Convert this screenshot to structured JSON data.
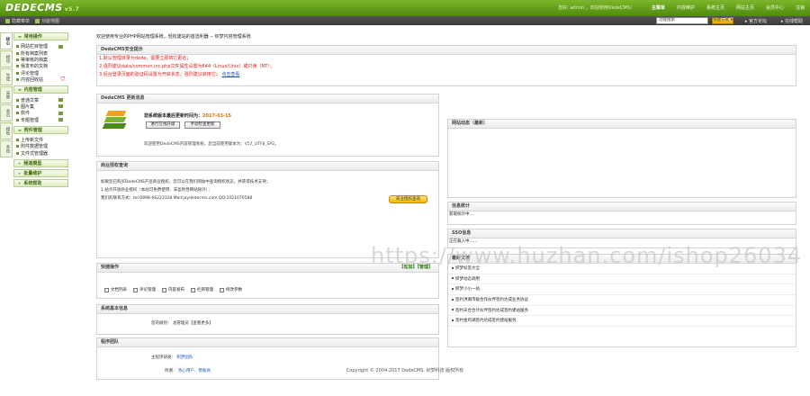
{
  "app": {
    "logo": "DEDECMS",
    "version": "v5.7"
  },
  "topnav": {
    "greeting": "您好: admin ，欢迎使用DedeCMS！",
    "items": [
      "主菜单",
      "内容维护",
      "系统主页",
      "网站主页",
      "会员中心",
      "注销"
    ],
    "active_index": 0
  },
  "subbar": {
    "left_items": [
      "隐藏菜单",
      "功能地图"
    ],
    "search_value": "功能搜索",
    "mode_button": "快捷方式 ▾",
    "link_forum": "官方论坛",
    "link_help": "在线帮助"
  },
  "vtabs": [
    "核心",
    "模块",
    "生成",
    "采集",
    "会员",
    "模板",
    "系统"
  ],
  "leftmenu": {
    "sections": [
      {
        "title": "常用操作",
        "items": [
          "网站栏目管理",
          "所有档案列表",
          "等审核的档案",
          "我发布的文档",
          "评论管理",
          "内容回收站"
        ]
      },
      {
        "title": "内容管理",
        "items": [
          "普通文章",
          "图片集",
          "软件",
          "专题管理"
        ]
      },
      {
        "title": "附件管理",
        "items": [
          "上传新文件",
          "附件数据管理",
          "文件式管理器"
        ]
      },
      {
        "title": "频道模型",
        "items": []
      },
      {
        "title": "批量维护",
        "items": []
      },
      {
        "title": "系统帮助",
        "items": []
      }
    ]
  },
  "main": {
    "welcome": "欢迎使用专业的PHP网站管理系统，轻松建站的首选利器 -- 织梦内容管理系统",
    "security": {
      "title": "DedeCMS安全提示",
      "lines": [
        "1.默认管理目录为dede，需要立即将它更名；",
        "2.强烈建议data/common.inc.php文件属性设置为644（Linux/Unix）或只读（NT）；",
        "3.后台登录页面的验证码设置为开启状态；强烈建议启用它；"
      ],
      "link": "点击查看"
    },
    "update": {
      "title": "DedeCMS 更新消息",
      "latest_label": "您系统版本最后更新时间为：",
      "latest_date": "2017-03-15",
      "btn_check": "进行在线升级",
      "btn_manual": "手动检查更新",
      "desc": "欢迎使用DedeCMS内容管理系统，您当前使用版本为：V57_UTF8_SP2。"
    },
    "business": {
      "title": "商业授权查询",
      "lines": [
        "如果您已购买DedeCMS产品商业授权，您可以在我们网站中查询授权状态，并获得技术支持；",
        "1.站点开放商业授权（本站可免费使用、非盈利性网站除外）；",
        "我们的联系方式：tel:0898-66223328 Mail:jaydedecms.com QQ:1021070588"
      ],
      "button": "商业授权查询"
    },
    "quick": {
      "title": "快捷操作",
      "right": "【增加】【管理】",
      "items": [
        "文档列表",
        "评论管理",
        "内容发布",
        "栏目管理",
        "修改参数"
      ]
    },
    "sysinfo": {
      "title": "系统基本信息",
      "label": "您的级别：",
      "value": "总管理员【查看更多】"
    },
    "team": {
      "title": "程序团队",
      "row1_label": "主程序研发：",
      "row1_value": "织梦团队",
      "row2_label": "鸣谢：",
      "row2_value": "热心用户、赞助商"
    },
    "right": {
      "panel1_title": "网站动态（最新）",
      "panel2_title": "信息统计",
      "panel2_line": "获取统计中...",
      "panel3_title": "SSO信息",
      "panel3_line": "正在载入中……",
      "news_title": "最新文档",
      "news": [
        "织梦标签大全",
        "织梦动态调用",
        "织梦小小一站",
        "签约洪湖市级合作伙伴签约达成业务协议",
        "签约天合合计伙伴签约达成签约建站服务",
        "签约金鸡湖签约达成签约建站服务"
      ]
    },
    "footer": "Copyright © 2004-2017 DedeCMS. 织梦科技 版权所有"
  },
  "watermark": "https://www.huzhan.com/ishop26034",
  "colors": {
    "brand_green": "#5a9b16",
    "warn_red": "#e21b1b",
    "link_blue": "#1a4fb0"
  }
}
